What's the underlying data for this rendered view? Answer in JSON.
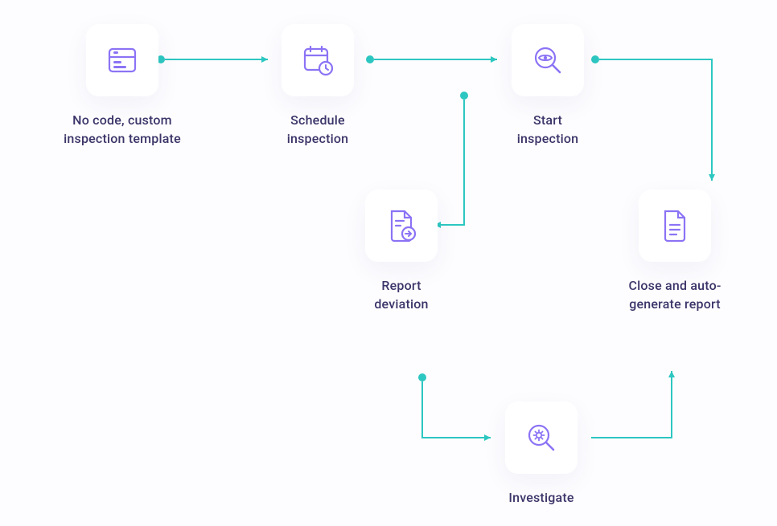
{
  "colors": {
    "icon": "#8C73F5",
    "connector": "#2DC7C1",
    "text": "#3b3569"
  },
  "nodes": {
    "template": {
      "label": "No code, custom\ninspection template"
    },
    "schedule": {
      "label": "Schedule\ninspection"
    },
    "start": {
      "label": "Start\ninspection"
    },
    "report": {
      "label": "Report\ndeviation"
    },
    "close": {
      "label": "Close and auto-\ngenerate report"
    },
    "investigate": {
      "label": "Investigate"
    }
  }
}
